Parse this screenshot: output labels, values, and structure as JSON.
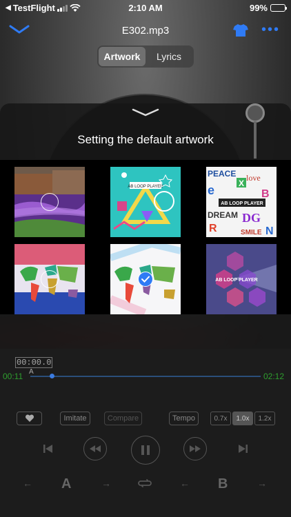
{
  "status_bar": {
    "carrier": "TestFlight",
    "time": "2:10 AM",
    "battery": "99%",
    "battery_level": 0.99
  },
  "nav": {
    "title": "E302.mp3"
  },
  "segments": [
    {
      "label": "Artwork",
      "active": true
    },
    {
      "label": "Lyrics",
      "active": false
    }
  ],
  "sheet": {
    "heading": "Setting the default artwork",
    "thumbnails": [
      {
        "name": "lavender-field",
        "state": "unselected"
      },
      {
        "name": "ab-loop-geometric",
        "label": "AB LOOP PLAYER",
        "state": "none"
      },
      {
        "name": "ab-loop-letters",
        "label": "AB LOOP PLAYER",
        "state": "none"
      },
      {
        "name": "world-map-dots",
        "state": "unselected"
      },
      {
        "name": "world-map-pastel",
        "state": "selected"
      },
      {
        "name": "ab-loop-hexagons",
        "label": "AB LOOP PLAYER",
        "state": "none"
      }
    ],
    "letters_words": [
      "PEACE",
      "love",
      "DREAM",
      "SMILE"
    ]
  },
  "player": {
    "position": "00:00.0",
    "marker": "A",
    "elapsed": "00:11",
    "duration": "02:12",
    "buttons": {
      "imitate": "Imitate",
      "compare": "Compare",
      "tempo": "Tempo"
    },
    "speeds": [
      "0.7x",
      "1.0x",
      "1.2x"
    ],
    "active_speed": "1.0x",
    "ab": {
      "a": "A",
      "b": "B"
    }
  },
  "colors": {
    "accent": "#2f7bf5",
    "time_green": "#2e9e2e"
  }
}
